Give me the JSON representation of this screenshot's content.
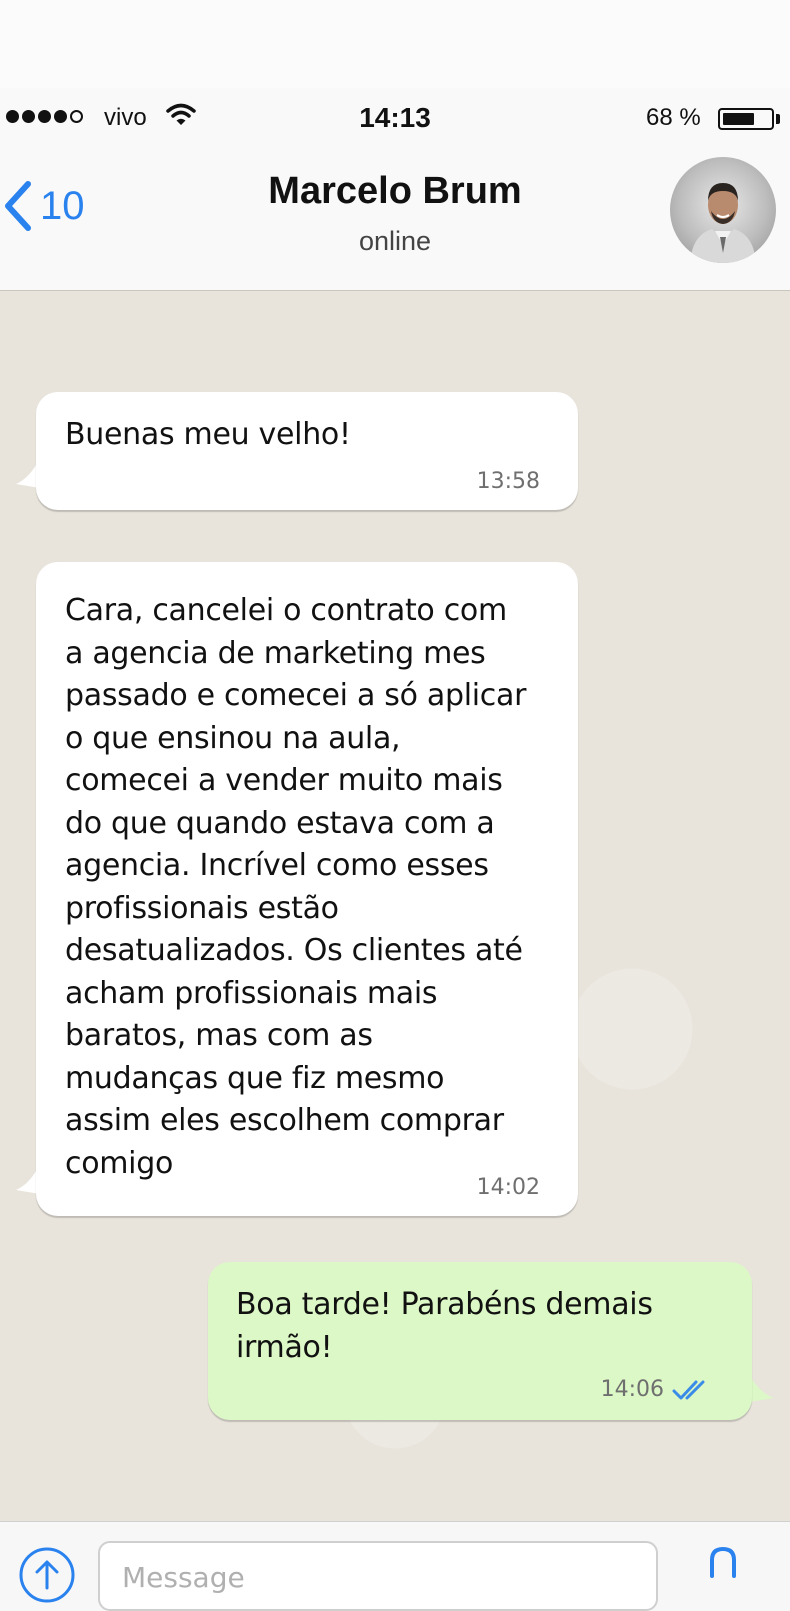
{
  "status_bar": {
    "carrier": "vivo",
    "time": "14:13",
    "battery_percent_label": "68 %",
    "battery_level": 0.68
  },
  "header": {
    "back_count": "10",
    "contact_name": "Marcelo Brum",
    "contact_status": "online"
  },
  "messages": [
    {
      "direction": "incoming",
      "text": "Buenas meu velho!",
      "time": "13:58"
    },
    {
      "direction": "incoming",
      "text": "Cara, cancelei o contrato com\na agencia de marketing mes\npassado e comecei a só aplicar\no que ensinou na aula,\ncomecei a vender muito mais\ndo que quando estava com a\nagencia. Incrível como esses\nprofissionais estão\ndesatualizados. Os clientes até\nacham profissionais mais\nbaratos, mas com as\nmudanças que fiz mesmo\nassim eles escolhem comprar\ncomigo",
      "time": "14:02"
    },
    {
      "direction": "outgoing",
      "text": "Boa tarde! Parabéns demais\nirmão!",
      "time": "14:06",
      "status_icon": "double-check-icon"
    }
  ],
  "input": {
    "placeholder": "Message"
  },
  "colors": {
    "accent": "#2a82ee",
    "chat_background": "#e8e4dc",
    "incoming_bubble": "#ffffff",
    "outgoing_bubble": "#dcf8c6"
  }
}
